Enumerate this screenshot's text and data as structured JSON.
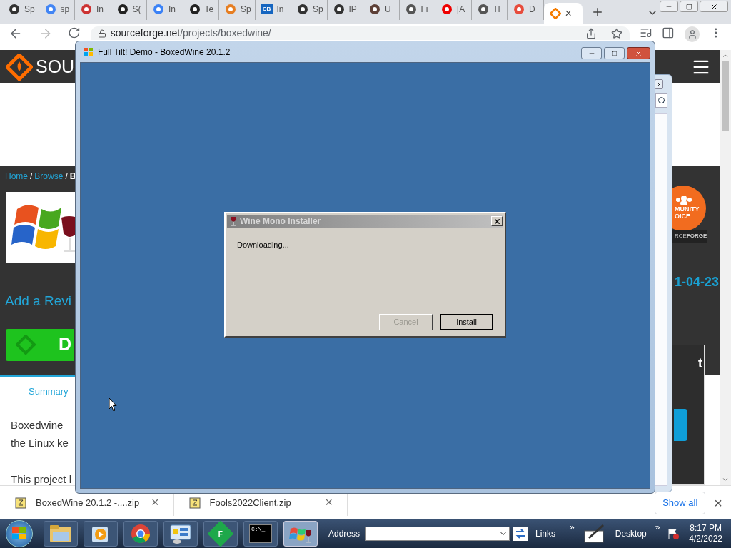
{
  "browser": {
    "tabs": [
      {
        "title": "Sp",
        "selected": false
      },
      {
        "title": "sp",
        "selected": false
      },
      {
        "title": "In",
        "selected": false
      },
      {
        "title": "S(",
        "selected": false
      },
      {
        "title": "In",
        "selected": false
      },
      {
        "title": "Te",
        "selected": false
      },
      {
        "title": "Sp",
        "selected": false
      },
      {
        "title": "In",
        "badge": "CB",
        "selected": false
      },
      {
        "title": "Sp",
        "selected": false
      },
      {
        "title": "IP",
        "selected": false
      },
      {
        "title": "U",
        "selected": false
      },
      {
        "title": "Fi",
        "selected": false
      },
      {
        "title": "[A",
        "selected": false
      },
      {
        "title": "Tl",
        "selected": false
      },
      {
        "title": "D",
        "selected": false
      },
      {
        "close": "×",
        "selected": true
      }
    ],
    "url_host": "sourceforge.net",
    "url_path": "/projects/boxedwine/"
  },
  "page": {
    "brand": "SOU",
    "breadcrumb": [
      {
        "label": "Home",
        "link": true
      },
      {
        "label": "Browse",
        "link": true
      },
      {
        "label": "B",
        "link": false
      }
    ],
    "separator": "/",
    "review_link": "Add a Revi",
    "download_button": "D",
    "badge": {
      "line_1": "MUNITY",
      "line_2": "OICE",
      "footer": "RCE**FORGE**"
    },
    "date": "1-04-23",
    "side_box": "t",
    "summary_tab": "Summary",
    "paragraph_lines": [
      "Boxedwine",
      "the Linux ke",
      "This project l"
    ]
  },
  "boxedwine_window": {
    "title": "Full Tilt! Demo - BoxedWine 20.1.2"
  },
  "dialog": {
    "title": "Wine Mono Installer",
    "message": "Downloading...",
    "buttons": [
      {
        "label": "Cancel",
        "disabled": true,
        "default": false
      },
      {
        "label": "Install",
        "disabled": false,
        "default": true
      }
    ]
  },
  "downloads": {
    "items": [
      {
        "name": "BoxedWine 20.1.2 -....zip",
        "close": "×"
      },
      {
        "name": "Fools2022Client.zip",
        "close": "×"
      }
    ],
    "show_all": "Show all",
    "close": "×"
  },
  "taskbar": {
    "apps": [
      {
        "selected": false
      },
      {
        "selected": false
      },
      {
        "selected": false
      },
      {
        "selected": false
      },
      {
        "selected": false,
        "label": "F"
      },
      {
        "selected": false,
        "label": "C:\\_"
      },
      {
        "selected": true
      }
    ],
    "address_label": "Address",
    "links": "Links",
    "links_more": "»",
    "desktop": "Desktop",
    "desktop_more": "»",
    "time": "8:17 PM",
    "date": "4/2/2022"
  }
}
